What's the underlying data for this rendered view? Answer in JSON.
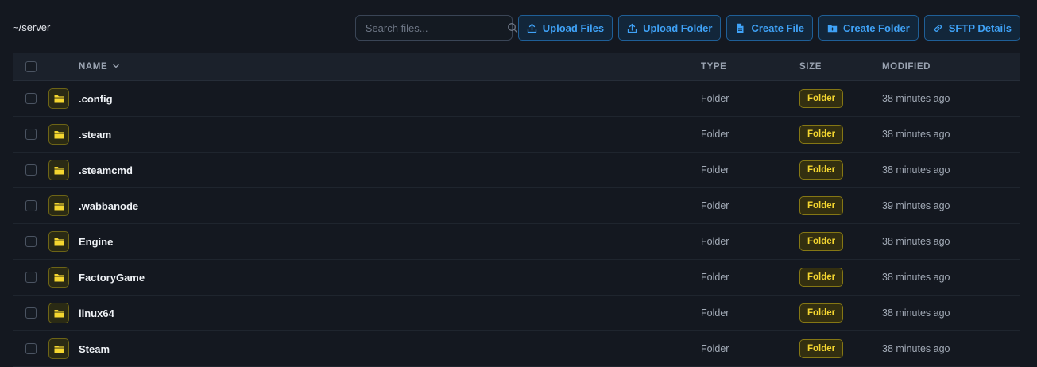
{
  "breadcrumb": "~/server",
  "search": {
    "placeholder": "Search files..."
  },
  "toolbar": {
    "upload_files": "Upload Files",
    "upload_folder": "Upload Folder",
    "create_file": "Create File",
    "create_folder": "Create Folder",
    "sftp_details": "SFTP Details"
  },
  "columns": {
    "name": "NAME",
    "type": "TYPE",
    "size": "SIZE",
    "modified": "MODIFIED"
  },
  "files": [
    {
      "name": ".config",
      "type": "Folder",
      "size": "Folder",
      "modified": "38 minutes ago"
    },
    {
      "name": ".steam",
      "type": "Folder",
      "size": "Folder",
      "modified": "38 minutes ago"
    },
    {
      "name": ".steamcmd",
      "type": "Folder",
      "size": "Folder",
      "modified": "38 minutes ago"
    },
    {
      "name": ".wabbanode",
      "type": "Folder",
      "size": "Folder",
      "modified": "39 minutes ago"
    },
    {
      "name": "Engine",
      "type": "Folder",
      "size": "Folder",
      "modified": "38 minutes ago"
    },
    {
      "name": "FactoryGame",
      "type": "Folder",
      "size": "Folder",
      "modified": "38 minutes ago"
    },
    {
      "name": "linux64",
      "type": "Folder",
      "size": "Folder",
      "modified": "38 minutes ago"
    },
    {
      "name": "Steam",
      "type": "Folder",
      "size": "Folder",
      "modified": "38 minutes ago"
    }
  ],
  "colors": {
    "accent": "#3fa2f7",
    "folder": "#f4d630",
    "background": "#141820"
  }
}
